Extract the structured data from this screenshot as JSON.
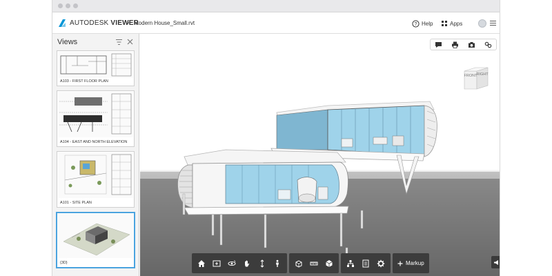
{
  "header": {
    "brand_name": "AUTODESK",
    "brand_product": "VIEWER",
    "breadcrumb_separator": "›",
    "file_name": "Modern House_Small.rvt",
    "help_label": "Help",
    "apps_label": "Apps",
    "icons": [
      "autodesk-logo-icon",
      "help-icon",
      "apps-grid-icon",
      "avatar",
      "menu-icon"
    ]
  },
  "sidebar": {
    "title": "Views",
    "views": [
      {
        "label": "A103 - FIRST FLOOR PLAN",
        "selected": false
      },
      {
        "label": "A104 - EAST AND NORTH ELEVATION",
        "selected": false
      },
      {
        "label": "A101 - SITE PLAN",
        "selected": false
      },
      {
        "label": "{3D}",
        "selected": true
      }
    ]
  },
  "viewport": {
    "top_tools": [
      "comment-icon",
      "print-icon",
      "camera-icon",
      "link-icon"
    ],
    "viewcube": {
      "front_label": "FRONT",
      "side_label": "RIGHT"
    },
    "toolbar": {
      "navigation": [
        "home-icon",
        "fit-view-icon",
        "orbit-icon",
        "pan-icon",
        "zoom-icon",
        "first-person-icon"
      ],
      "analysis": [
        "section-icon",
        "measure-icon",
        "explode-icon"
      ],
      "model": [
        "model-browser-icon",
        "properties-icon",
        "settings-icon"
      ],
      "markup_label": "Markup"
    }
  },
  "colors": {
    "accent": "#4aa3df",
    "toolbar_bg": "#3c3c3c",
    "glass": "#8fcbe6",
    "autodesk_logo": "#0696d7"
  }
}
